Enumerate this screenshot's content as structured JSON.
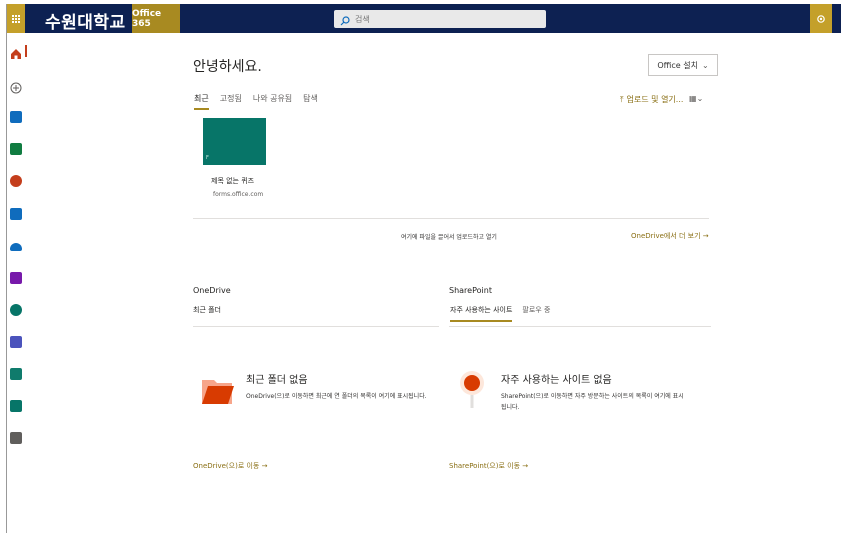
{
  "header": {
    "brand": "수원대학교",
    "suite_label": "Office 365",
    "search_placeholder": "검색"
  },
  "rail": {
    "apps": [
      {
        "name": "home",
        "color": "#c43e1c"
      },
      {
        "name": "add",
        "color": "#605e5c"
      },
      {
        "name": "outlook",
        "color": "#0f6cbd"
      },
      {
        "name": "excel",
        "color": "#107c41"
      },
      {
        "name": "powerpoint",
        "color": "#c43e1c"
      },
      {
        "name": "outlook-2",
        "color": "#0f6cbd"
      },
      {
        "name": "onedrive",
        "color": "#0f6cbd"
      },
      {
        "name": "onenote",
        "color": "#7719aa"
      },
      {
        "name": "sharepoint",
        "color": "#077568"
      },
      {
        "name": "teams",
        "color": "#4b53bc"
      },
      {
        "name": "sway",
        "color": "#0f7b6c"
      },
      {
        "name": "forms",
        "color": "#077568"
      },
      {
        "name": "other",
        "color": "#605e5c"
      }
    ]
  },
  "main": {
    "greeting": "안녕하세요.",
    "install_label": "Office 설치",
    "tabs": [
      {
        "label": "최근",
        "active": true
      },
      {
        "label": "고정됨",
        "active": false
      },
      {
        "label": "나와 공유됨",
        "active": false
      },
      {
        "label": "탐색",
        "active": false
      }
    ],
    "upload_label": "업로드 및 열기...",
    "recent_file": {
      "title": "제목 없는 퀴즈",
      "source": "forms.office.com"
    },
    "drop_hint": "여기에 파일을 끌어서 업로드하고 열기",
    "onedrive_more": "OneDrive에서 더 보기 →"
  },
  "onedrive": {
    "heading": "OneDrive",
    "subheading": "최근 폴더",
    "empty_title": "최근 폴더 없음",
    "empty_desc": "OneDrive(으)로 이동하면 최근에 연 폴더의 목록이 여기에 표시됩니다.",
    "go_link": "OneDrive(으)로 이동 →"
  },
  "sharepoint": {
    "heading": "SharePoint",
    "tabs": [
      {
        "label": "자주 사용하는 사이트",
        "active": true
      },
      {
        "label": "팔로우 중",
        "active": false
      }
    ],
    "empty_title": "자주 사용하는 사이트 없음",
    "empty_desc": "SharePoint(으)로 이동하면 자주 방문하는 사이트의 목록이 여기에 표시됩니다.",
    "go_link": "SharePoint(으)로 이동 →"
  },
  "colors": {
    "topbar": "#0d2152",
    "accent": "#c4a02a",
    "link": "#8a6f14"
  }
}
